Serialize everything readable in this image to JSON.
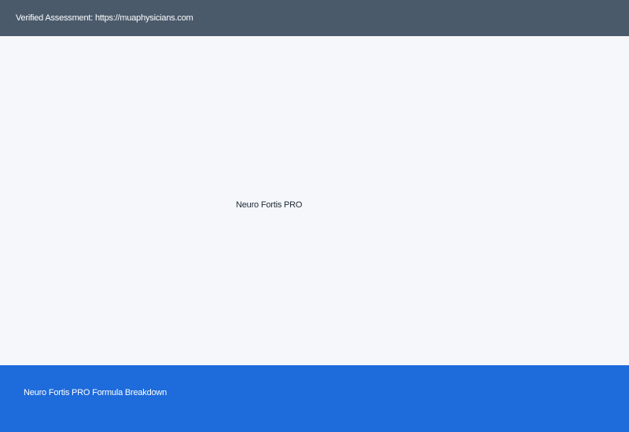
{
  "header": {
    "text": "Verified Assessment: https://muaphysicians.com"
  },
  "main": {
    "product_name": "Neuro Fortis PRO"
  },
  "footer": {
    "link_text": "Neuro Fortis PRO Formula Breakdown"
  },
  "colors": {
    "header_background": "#4a5a6b",
    "page_background": "#f5f7fa",
    "footer_background": "#1e6bdb",
    "text_dark": "#1f2a36",
    "text_light": "#ffffff"
  }
}
